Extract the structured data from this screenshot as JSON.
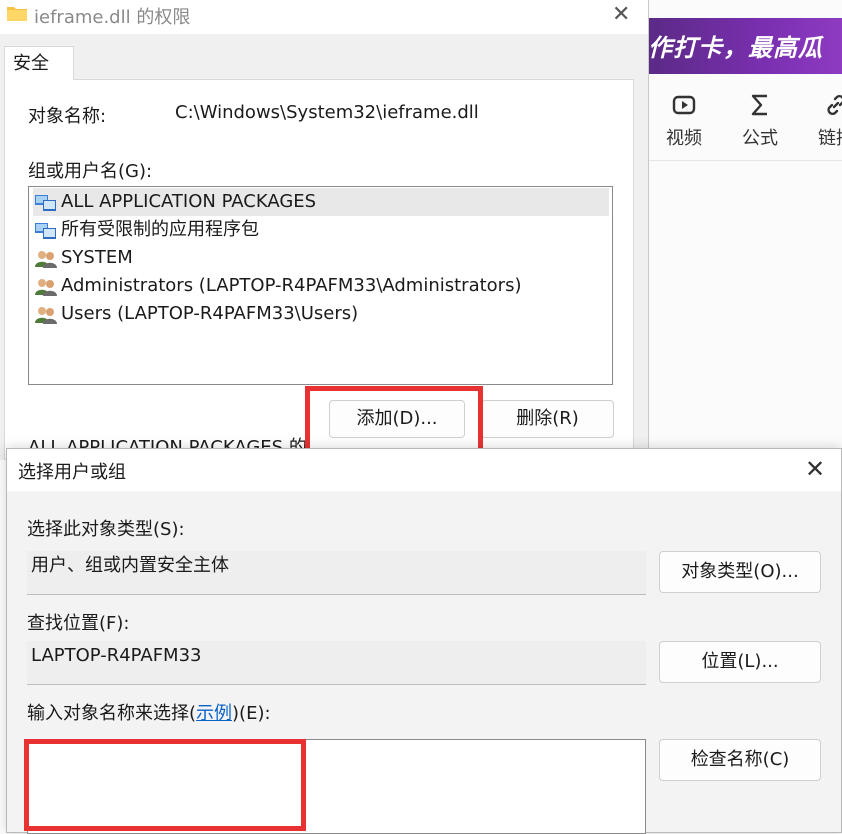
{
  "background_app": {
    "banner_text": "作打卡，最高瓜",
    "tools": [
      {
        "icon": "video-icon",
        "label": "视频"
      },
      {
        "icon": "formula-icon",
        "label": "公式"
      },
      {
        "icon": "link-icon",
        "label": "链接"
      }
    ]
  },
  "permissions_window": {
    "title": "ieframe.dll 的权限",
    "tab": "安全",
    "object_name_label": "对象名称:",
    "object_name_value": "C:\\Windows\\System32\\ieframe.dll",
    "groups_label": "组或用户名(G):",
    "groups": [
      {
        "icon": "package-group-icon",
        "name": "ALL APPLICATION PACKAGES",
        "selected": true
      },
      {
        "icon": "package-group-icon",
        "name": "所有受限制的应用程序包",
        "selected": false
      },
      {
        "icon": "users-icon",
        "name": "SYSTEM",
        "selected": false
      },
      {
        "icon": "users-icon",
        "name": "Administrators (LAPTOP-R4PAFM33\\Administrators)",
        "selected": false
      },
      {
        "icon": "users-icon",
        "name": "Users (LAPTOP-R4PAFM33\\Users)",
        "selected": false
      }
    ],
    "add_button": "添加(D)...",
    "remove_button": "删除(R)",
    "permissions_for_label_partial": "ALL APPLICATION PACKAGES 的"
  },
  "select_dialog": {
    "title": "选择用户或组",
    "object_type_label": "选择此对象类型(S):",
    "object_type_value": "用户、组或内置安全主体",
    "object_types_button": "对象类型(O)...",
    "location_label": "查找位置(F):",
    "location_value": "LAPTOP-R4PAFM33",
    "locations_button": "位置(L)...",
    "enter_names_label_prefix": "输入对象名称来选择(",
    "examples_link": "示例",
    "enter_names_label_suffix": ")(E):",
    "names_input_value": "",
    "check_names_button": "检查名称(C)"
  },
  "colors": {
    "highlight": "#e83232",
    "link": "#0a62c9",
    "banner": "#7a2fb0"
  }
}
